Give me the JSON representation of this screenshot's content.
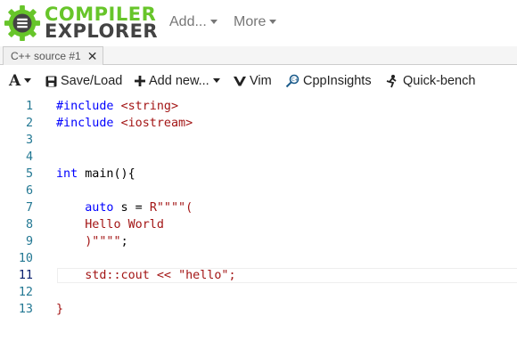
{
  "brand": {
    "line1": "COMPILER",
    "line2": "EXPLORER",
    "green": "#67c52a",
    "dark": "#434343"
  },
  "nav": {
    "add": "Add...",
    "more": "More"
  },
  "tab": {
    "title": "C++ source #1",
    "close": "✕"
  },
  "toolbar": {
    "font_icon": "A",
    "save_load": "Save/Load",
    "add_new": "Add new...",
    "vim": "Vim",
    "cppinsights": "CppInsights",
    "quickbench": "Quick-bench"
  },
  "editor": {
    "active_line": 11,
    "lines": [
      {
        "num": "1",
        "parts": [
          {
            "t": "#include ",
            "c": "kw"
          },
          {
            "t": "<string>",
            "c": "str"
          }
        ]
      },
      {
        "num": "2",
        "parts": [
          {
            "t": "#include ",
            "c": "kw"
          },
          {
            "t": "<iostream>",
            "c": "str"
          }
        ]
      },
      {
        "num": "3",
        "parts": []
      },
      {
        "num": "4",
        "parts": []
      },
      {
        "num": "5",
        "parts": [
          {
            "t": "int",
            "c": "kw"
          },
          {
            "t": " main(){",
            "c": ""
          }
        ]
      },
      {
        "num": "6",
        "parts": []
      },
      {
        "num": "7",
        "parts": [
          {
            "t": "    ",
            "c": ""
          },
          {
            "t": "auto",
            "c": "kw"
          },
          {
            "t": " s = ",
            "c": ""
          },
          {
            "t": "R\"\"\"\"(",
            "c": "str"
          }
        ]
      },
      {
        "num": "8",
        "parts": [
          {
            "t": "    ",
            "c": ""
          },
          {
            "t": "Hello World",
            "c": "str"
          }
        ]
      },
      {
        "num": "9",
        "parts": [
          {
            "t": "    ",
            "c": ""
          },
          {
            "t": ")\"\"\"\"",
            "c": "str"
          },
          {
            "t": ";",
            "c": ""
          }
        ]
      },
      {
        "num": "10",
        "parts": []
      },
      {
        "num": "11",
        "parts": [
          {
            "t": "    ",
            "c": ""
          },
          {
            "t": "std::cout << ",
            "c": "str"
          },
          {
            "t": "\"hello\"",
            "c": "str"
          },
          {
            "t": ";",
            "c": "str"
          }
        ]
      },
      {
        "num": "12",
        "parts": []
      },
      {
        "num": "13",
        "parts": [
          {
            "t": "}",
            "c": "str"
          }
        ]
      }
    ]
  }
}
